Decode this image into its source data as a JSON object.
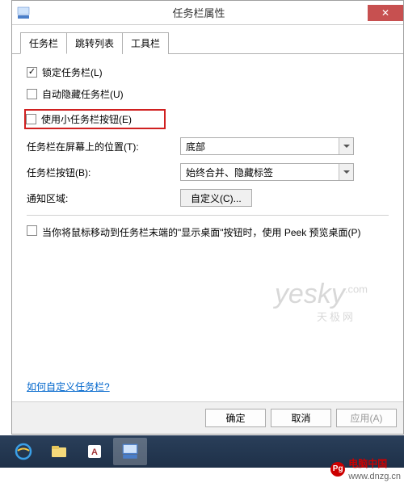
{
  "window": {
    "title": "任务栏属性",
    "close_glyph": "✕"
  },
  "tabs": [
    {
      "label": "任务栏",
      "active": true
    },
    {
      "label": "跳转列表",
      "active": false
    },
    {
      "label": "工具栏",
      "active": false
    }
  ],
  "options": {
    "lock": {
      "label": "锁定任务栏(L)",
      "checked": true
    },
    "autohide": {
      "label": "自动隐藏任务栏(U)",
      "checked": false
    },
    "small_buttons": {
      "label": "使用小任务栏按钮(E)",
      "checked": false,
      "highlighted": true
    },
    "position": {
      "label": "任务栏在屏幕上的位置(T):",
      "value": "底部"
    },
    "buttons": {
      "label": "任务栏按钮(B):",
      "value": "始终合并、隐藏标签"
    },
    "notify": {
      "label": "通知区域:",
      "button": "自定义(C)..."
    },
    "peek": {
      "label": "当你将鼠标移动到任务栏末端的\"显示桌面\"按钮时，使用 Peek 预览桌面(P)",
      "checked": false
    }
  },
  "custom_link": "如何自定义任务栏?",
  "buttons": {
    "ok": "确定",
    "cancel": "取消",
    "apply": "应用(A)"
  },
  "watermarks": {
    "yesky": "yesky",
    "yesky_com": ".com",
    "yesky_sub": "天极网",
    "dnzg_name": "电脑中国",
    "dnzg_url": "www.dnzg.cn"
  }
}
